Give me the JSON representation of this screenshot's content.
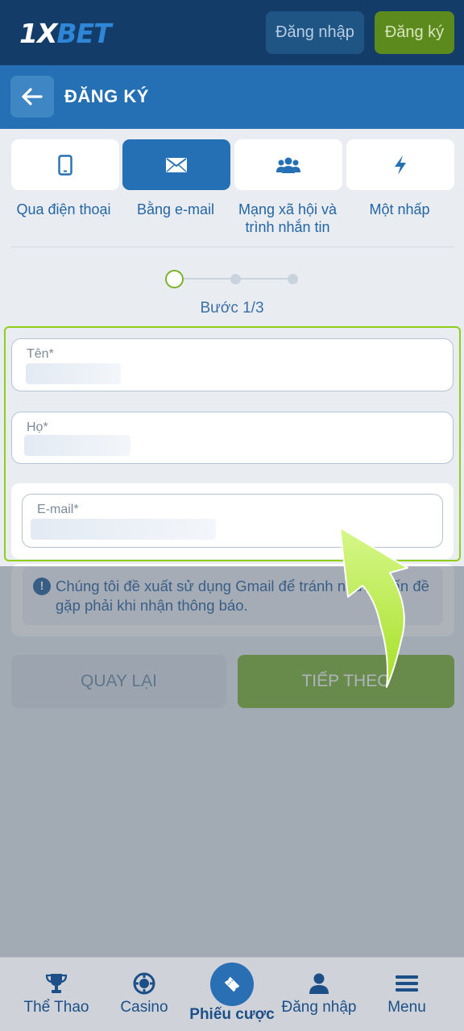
{
  "header": {
    "logo_main": "1X",
    "logo_accent": "BET",
    "login_label": "Đăng nhập",
    "register_label": "Đăng ký"
  },
  "titlebar": {
    "title": "ĐĂNG KÝ"
  },
  "tabs": [
    {
      "label": "Qua điện thoại",
      "icon": "phone-icon",
      "active": false
    },
    {
      "label": "Bằng e-mail",
      "icon": "mail-icon",
      "active": true
    },
    {
      "label": "Mạng xã hội và trình nhắn tin",
      "icon": "users-icon",
      "active": false
    },
    {
      "label": "Một nhấp",
      "icon": "bolt-icon",
      "active": false
    }
  ],
  "stepper": {
    "label": "Bước 1/3",
    "current": 1,
    "total": 3
  },
  "form": {
    "first_name_label": "Tên*",
    "last_name_label": "Họ*",
    "email_label": "E-mail*"
  },
  "info": {
    "text": "Chúng tôi đề xuất sử dụng Gmail để tránh những vấn đề gặp phải khi nhận thông báo."
  },
  "actions": {
    "back_label": "QUAY LẠI",
    "next_label": "TIẾP THEO"
  },
  "bottom_nav": {
    "sports": "Thể Thao",
    "casino": "Casino",
    "betslip": "Phiếu cược",
    "login": "Đăng nhập",
    "menu": "Menu"
  },
  "colors": {
    "header_bg": "#143c68",
    "title_bg": "#2570b4",
    "accent_green": "#7ab22c",
    "highlight_border": "#8fce1a"
  }
}
